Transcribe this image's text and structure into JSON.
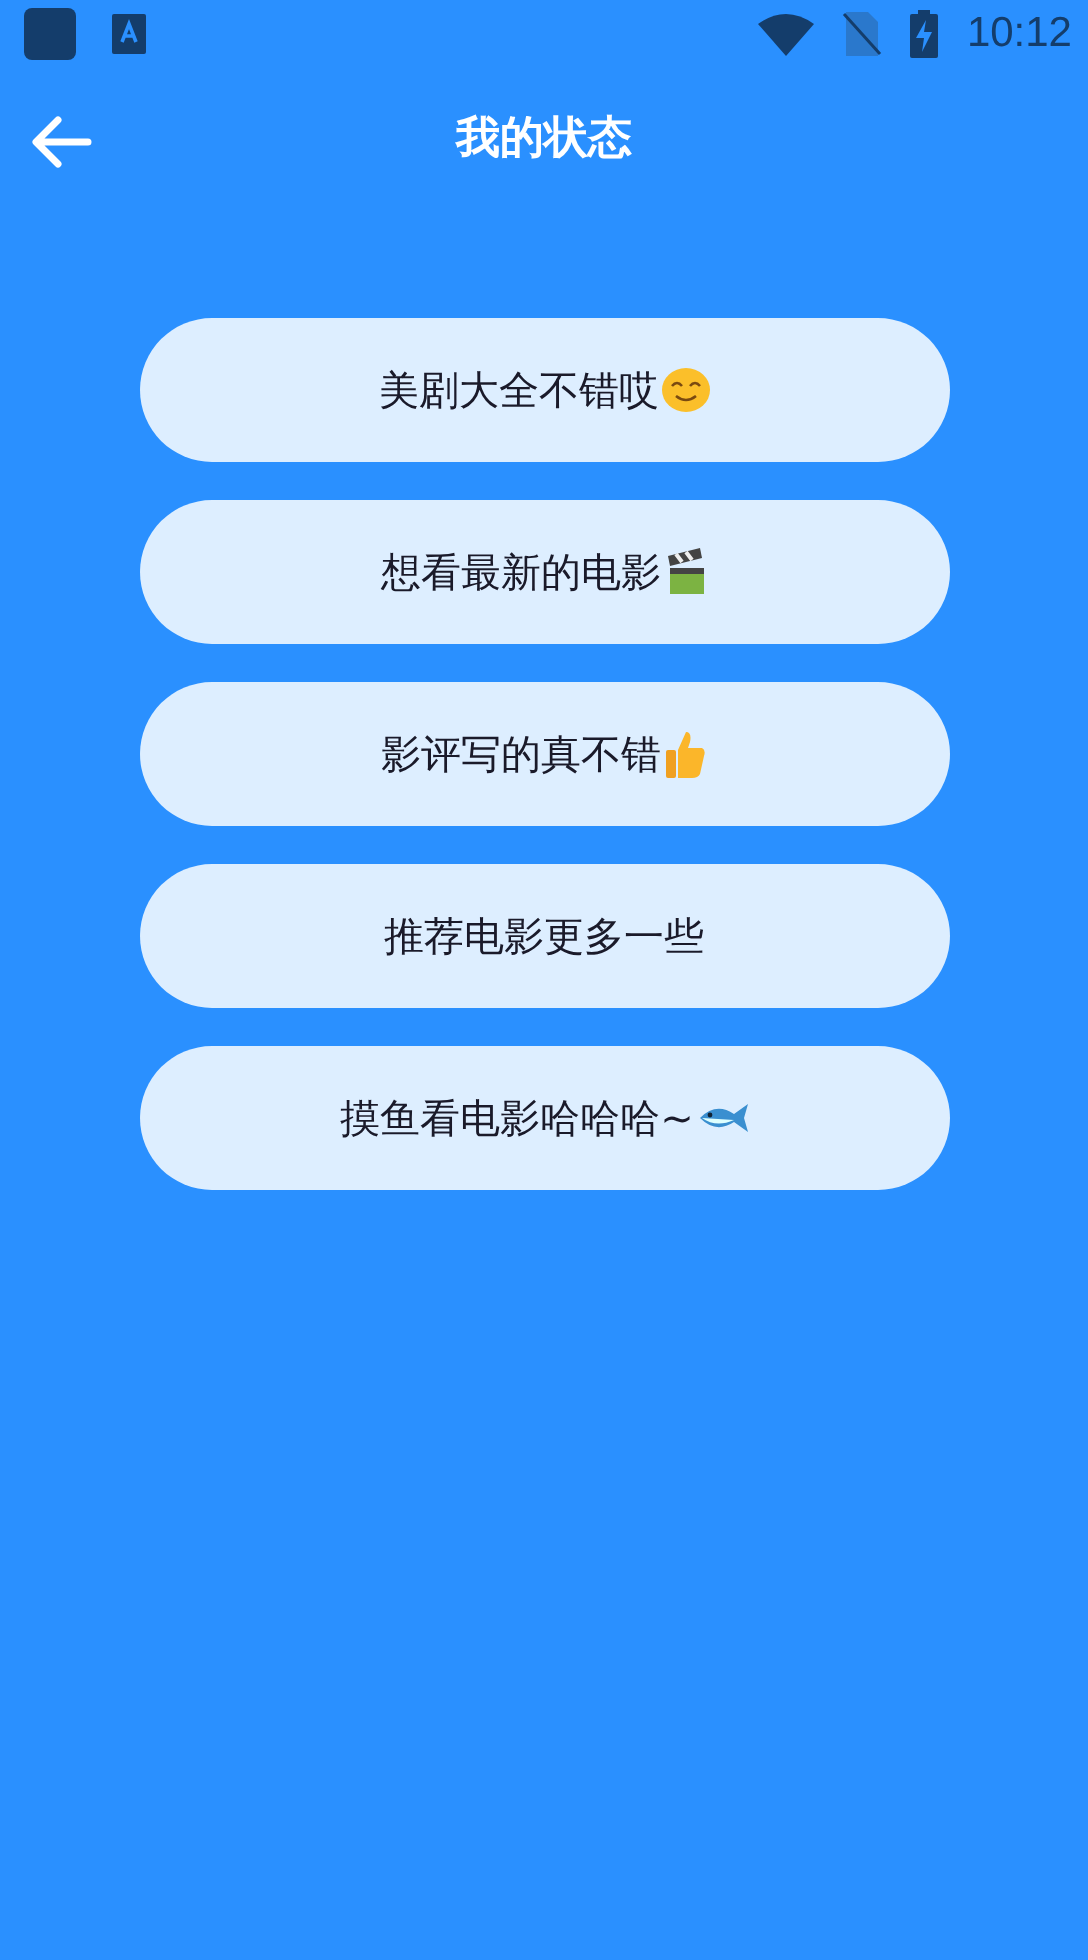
{
  "status_bar": {
    "time": "10:12"
  },
  "header": {
    "title": "我的状态"
  },
  "items": [
    {
      "label": "美剧大全不错哎",
      "kind": "smile"
    },
    {
      "label": "想看最新的电影",
      "kind": "clapper"
    },
    {
      "label": "影评写的真不错",
      "kind": "thumbs"
    },
    {
      "label": "推荐电影更多一些",
      "kind": "plain"
    },
    {
      "label": "摸鱼看电影哈哈哈~",
      "kind": "fish"
    }
  ]
}
